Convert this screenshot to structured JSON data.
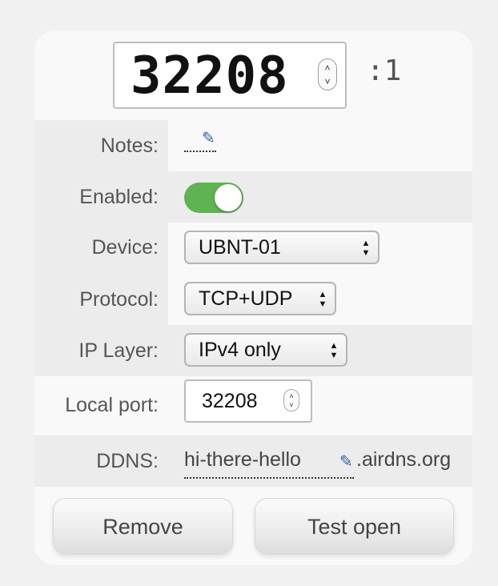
{
  "port": {
    "value": "32208",
    "index": ":1"
  },
  "rows": {
    "notes": {
      "label": "Notes:",
      "value": ""
    },
    "enabled": {
      "label": "Enabled:",
      "state": "on",
      "color": "#60b353"
    },
    "device": {
      "label": "Device:",
      "selected": "UBNT-01"
    },
    "protocol": {
      "label": "Protocol:",
      "selected": "TCP+UDP"
    },
    "ip_layer": {
      "label": "IP Layer:",
      "selected": "IPv4 only"
    },
    "local_port": {
      "label": "Local port:",
      "value": "32208"
    },
    "ddns": {
      "label": "DDNS:",
      "subdomain": "hi-there-hello",
      "domain": ".airdns.org"
    }
  },
  "icons": {
    "pencil": "✎",
    "stepper_up": "˄",
    "stepper_down": "˅",
    "select_arrows": "▲▼"
  },
  "buttons": {
    "remove": "Remove",
    "test_open": "Test open"
  }
}
